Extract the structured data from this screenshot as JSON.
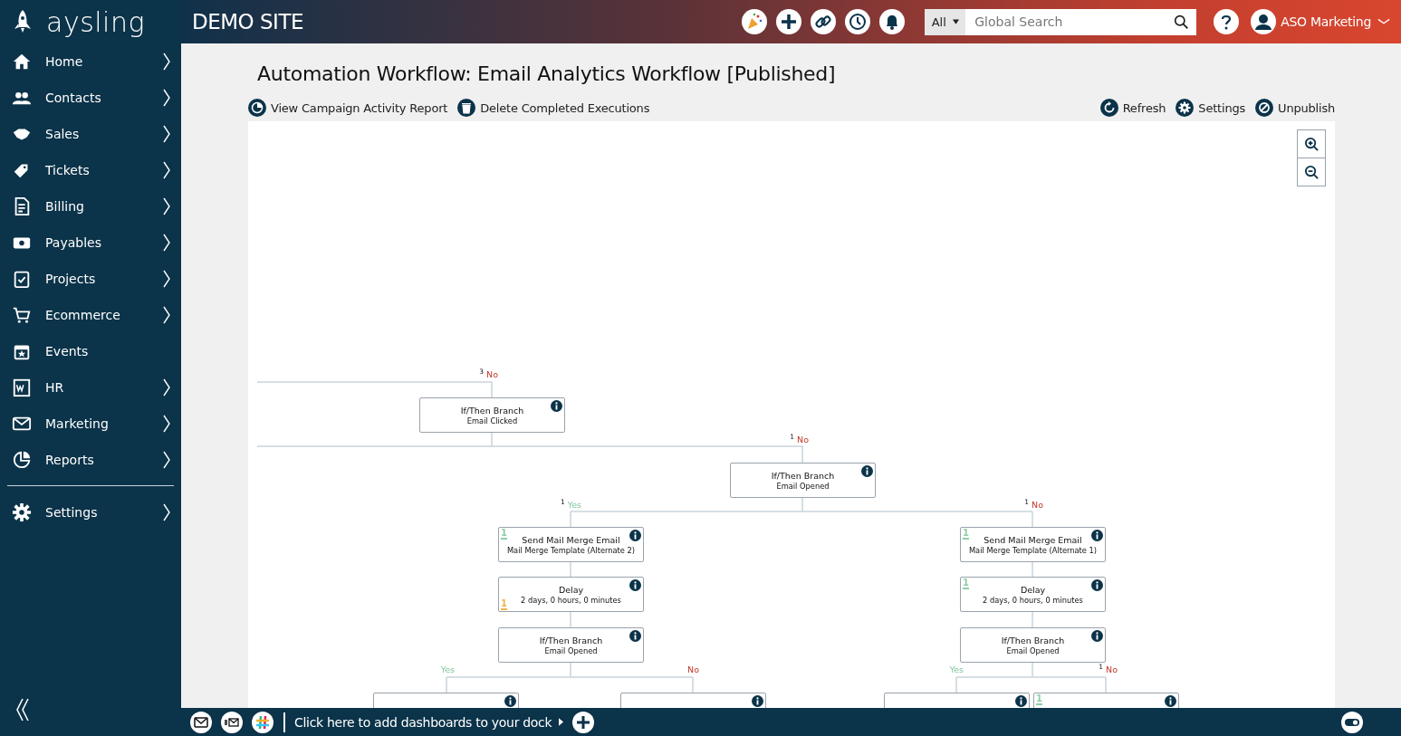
{
  "brand": {
    "logo_text": "aysling",
    "site": "DEMO SITE"
  },
  "search": {
    "scope": "All",
    "placeholder": "Global Search"
  },
  "user": {
    "name": "ASO Marketing"
  },
  "sidebar": {
    "items": [
      {
        "label": "Home",
        "has_submenu": true
      },
      {
        "label": "Contacts",
        "has_submenu": true
      },
      {
        "label": "Sales",
        "has_submenu": true
      },
      {
        "label": "Tickets",
        "has_submenu": true
      },
      {
        "label": "Billing",
        "has_submenu": true
      },
      {
        "label": "Payables",
        "has_submenu": true
      },
      {
        "label": "Projects",
        "has_submenu": true
      },
      {
        "label": "Ecommerce",
        "has_submenu": true
      },
      {
        "label": "Events",
        "has_submenu": false
      },
      {
        "label": "HR",
        "has_submenu": true
      },
      {
        "label": "Marketing",
        "has_submenu": true
      },
      {
        "label": "Reports",
        "has_submenu": true
      }
    ],
    "footer_items": [
      {
        "label": "Settings",
        "has_submenu": true
      }
    ]
  },
  "page": {
    "title": "Automation Workflow: Email Analytics Workflow [Published]",
    "actions_left": [
      {
        "label": "View Campaign Activity Report"
      },
      {
        "label": "Delete Completed Executions"
      }
    ],
    "actions_right": [
      {
        "label": "Refresh"
      },
      {
        "label": "Settings"
      },
      {
        "label": "Unpublish"
      }
    ]
  },
  "workflow": {
    "nodes": [
      {
        "kind": "full",
        "title": "If/Then Branch",
        "subtitle": "Email Clicked"
      },
      {
        "kind": "full",
        "title": "If/Then Branch",
        "subtitle": "Email Opened"
      },
      {
        "kind": "full",
        "title": "Send Mail Merge Email",
        "subtitle": "Mail Merge Template (Alternate 2)",
        "count": {
          "value": "1",
          "color": "#8fcfa6"
        }
      },
      {
        "kind": "full",
        "title": "Delay",
        "subtitle": "2 days, 0 hours, 0 minutes",
        "count": {
          "value": "1",
          "color": "#f0b24a"
        }
      },
      {
        "kind": "full",
        "title": "If/Then Branch",
        "subtitle": "Email Opened"
      },
      {
        "kind": "full",
        "title": "Send Mail Merge Email",
        "subtitle": "Mail Merge Template (Alternate 1)",
        "count": {
          "value": "1",
          "color": "#8fcfa6"
        }
      },
      {
        "kind": "full",
        "title": "Delay",
        "subtitle": "2 days, 0 hours, 0 minutes",
        "count": {
          "value": "1",
          "color": "#8fcfa6"
        }
      },
      {
        "kind": "full",
        "title": "If/Then Branch",
        "subtitle": "Email Opened"
      },
      {
        "kind": "cut_off"
      },
      {
        "kind": "cut_off"
      },
      {
        "kind": "cut_off"
      },
      {
        "kind": "cut_off",
        "count": {
          "value": "1",
          "color": "#8fcfa6"
        }
      }
    ],
    "branch_labels": [
      {
        "count": "3",
        "text": "No",
        "kind": "no"
      },
      {
        "count": "1",
        "text": "No",
        "kind": "no"
      },
      {
        "count": "1",
        "text": "Yes",
        "kind": "yes"
      },
      {
        "count": "1",
        "text": "No",
        "kind": "no"
      },
      {
        "text": "Yes",
        "kind": "yes"
      },
      {
        "text": "No",
        "kind": "no"
      },
      {
        "text": "Yes",
        "kind": "yes"
      },
      {
        "count": "1",
        "text": "No",
        "kind": "no"
      }
    ]
  },
  "dock": {
    "text": "Click here to add dashboards to your dock"
  }
}
